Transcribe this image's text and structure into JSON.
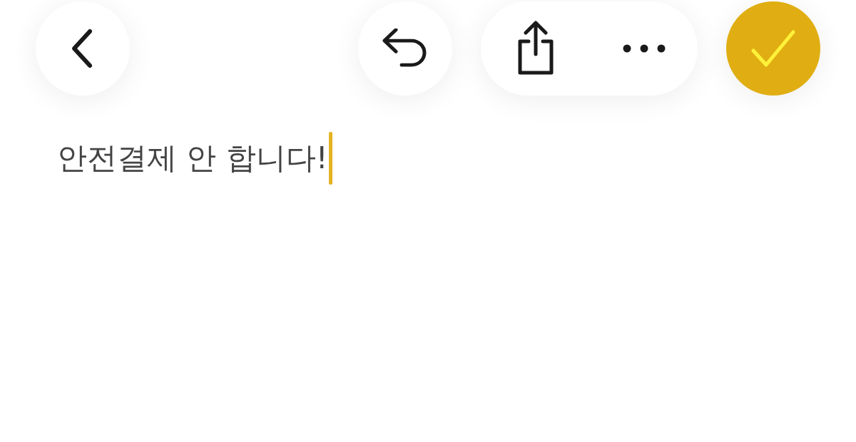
{
  "note": {
    "text": "안전결제 안 합니다!"
  }
}
